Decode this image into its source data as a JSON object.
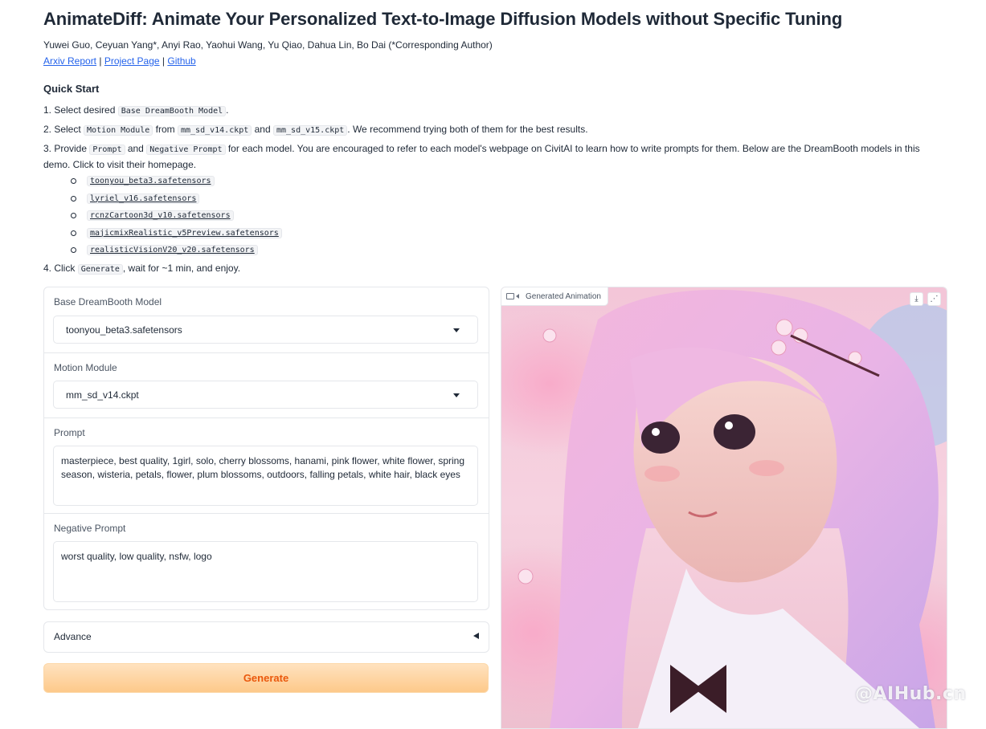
{
  "title": "AnimateDiff: Animate Your Personalized Text-to-Image Diffusion Models without Specific Tuning",
  "authors": "Yuwei Guo, Ceyuan Yang*, Anyi Rao, Yaohui Wang, Yu Qiao, Dahua Lin, Bo Dai (*Corresponding Author)",
  "links": {
    "arxiv": "Arxiv Report",
    "project": "Project Page",
    "github": "Github",
    "sep": "|"
  },
  "quick_start": {
    "heading": "Quick Start",
    "step1": {
      "pre": "1. Select desired ",
      "code": "Base DreamBooth Model",
      "post": "."
    },
    "step2": {
      "pre": "2. Select ",
      "code1": "Motion Module",
      "mid1": " from ",
      "code2": "mm_sd_v14.ckpt",
      "mid2": " and ",
      "code3": "mm_sd_v15.ckpt",
      "post": ". We recommend trying both of them for the best results."
    },
    "step3": {
      "pre": "3. Provide ",
      "code1": "Prompt",
      "mid": " and ",
      "code2": "Negative Prompt",
      "post": " for each model. You are encouraged to refer to each model's webpage on CivitAI to learn how to write prompts for them. Below are the DreamBooth models in this demo. Click to visit their homepage."
    },
    "models": [
      "toonyou_beta3.safetensors",
      "lyriel_v16.safetensors",
      "rcnzCartoon3d_v10.safetensors",
      "majicmixRealistic_v5Preview.safetensors",
      "realisticVisionV20_v20.safetensors"
    ],
    "step4": {
      "pre": "4. Click ",
      "code": "Generate",
      "post": ", wait for ~1 min, and enjoy."
    }
  },
  "form": {
    "base_model": {
      "label": "Base DreamBooth Model",
      "value": "toonyou_beta3.safetensors"
    },
    "motion_module": {
      "label": "Motion Module",
      "value": "mm_sd_v14.ckpt"
    },
    "prompt": {
      "label": "Prompt",
      "value": "masterpiece, best quality, 1girl, solo, cherry blossoms, hanami, pink flower, white flower, spring season, wisteria, petals, flower, plum blossoms, outdoors, falling petals, white hair, black eyes"
    },
    "negative_prompt": {
      "label": "Negative Prompt",
      "value": "worst quality, low quality, nsfw, logo"
    },
    "advance_label": "Advance",
    "generate_label": "Generate"
  },
  "output": {
    "label": "Generated Animation"
  },
  "watermark": "@AIHub.cn",
  "icons": {
    "video": "video-camera-icon",
    "download": "download-icon",
    "share": "share-icon"
  }
}
